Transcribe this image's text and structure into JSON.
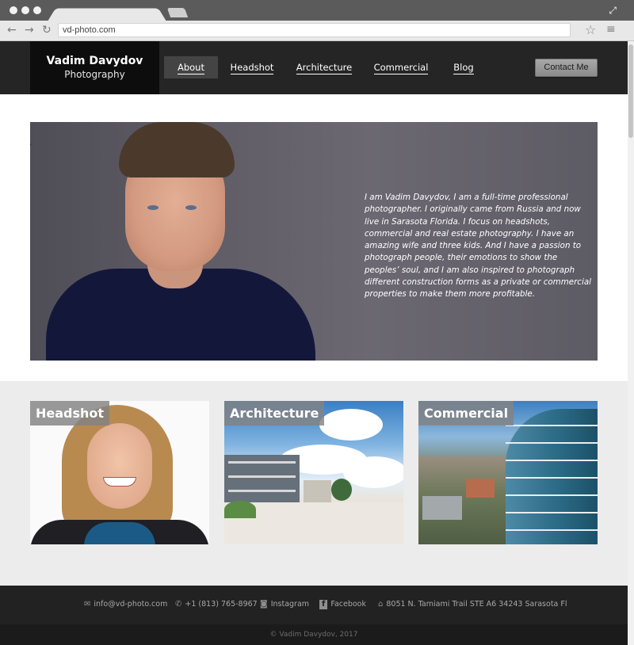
{
  "browser": {
    "url": "vd-photo.com",
    "back": "←",
    "forward": "→",
    "reload": "↻",
    "star": "☆",
    "menu": "≡",
    "expand": "⤢"
  },
  "site": {
    "logo_name": "Vadim Davydov",
    "logo_sub": "Photography",
    "nav": [
      {
        "label": "About"
      },
      {
        "label": "Headshot"
      },
      {
        "label": "Architecture"
      },
      {
        "label": "Commercial"
      },
      {
        "label": "Blog"
      }
    ],
    "contact_label": "Contact Me"
  },
  "hero": {
    "text": "I am Vadim Davydov, I am a full-time professional photographer. I originally came from Russia and now live in Sarasota Florida. I focus on headshots, commercial and real estate photography. I have an amazing wife and three kids. And I have a passion to photograph people, their emotions to show the peoples’ soul, and I am also inspired to photograph different construction forms as a private or commercial properties to make them more profitable."
  },
  "gallery": {
    "cards": [
      {
        "title": "Headshot"
      },
      {
        "title": "Architecture"
      },
      {
        "title": "Commercial"
      }
    ]
  },
  "footer": {
    "email": "info@vd-photo.com",
    "phone": "+1 (813) 765-8967",
    "instagram": "Instagram",
    "facebook": "Facebook",
    "address": "8051 N. Tamiami Trail STE A6 34243 Sarasota Fl",
    "copyright": "© Vadim Davydov, 2017"
  },
  "icons": {
    "email": "✉",
    "phone": "✆",
    "instagram": "◙",
    "facebook": "f",
    "address": "⌂"
  }
}
